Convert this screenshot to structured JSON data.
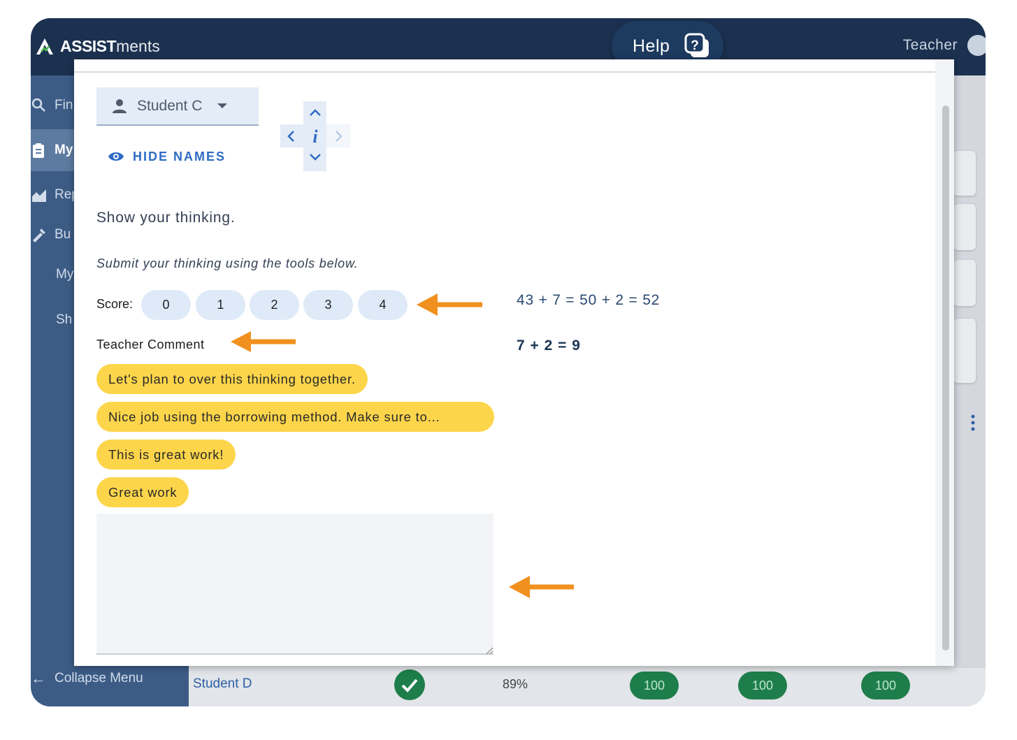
{
  "app": {
    "logo_bold": "ASSIST",
    "logo_thin": "ments",
    "user_role": "Teacher",
    "help_label": "Help"
  },
  "sidebar": {
    "items": [
      {
        "label": "Fin",
        "icon": "search-icon"
      },
      {
        "label": "My",
        "icon": "clipboard-icon"
      },
      {
        "label": "Rep",
        "icon": "chart-icon"
      },
      {
        "label": "Bu",
        "icon": "build-icon"
      },
      {
        "label": "My",
        "icon": ""
      },
      {
        "label": "Sh",
        "icon": ""
      }
    ],
    "collapse_label": "Collapse Menu"
  },
  "background_row": {
    "student": "Student D",
    "percent": "89%",
    "scores": [
      "100",
      "100",
      "100"
    ]
  },
  "modal": {
    "student_select": "Student C",
    "hide_names": "HIDE NAMES",
    "prompt": "Show your thinking.",
    "instruction": "Submit your thinking using the tools below.",
    "score_label": "Score:",
    "score_options": [
      "0",
      "1",
      "2",
      "3",
      "4"
    ],
    "teacher_comment_label": "Teacher Comment",
    "comment_chips": [
      "Let's plan to over this thinking together.",
      "Nice job using the borrowing method. Make sure to...",
      "This is great work!",
      "Great work"
    ],
    "comment_value": "",
    "student_answer": {
      "line1": "43 + 7 = 50 + 2 = 52",
      "line2": "7 + 2 = 9"
    }
  },
  "colors": {
    "topbar": "#1c3150",
    "sidebar": "#3c5c86",
    "chip": "#fdd54a",
    "score_pill": "#dfeaf8",
    "arrow": "#f0901e",
    "accent": "#2f6bc4"
  }
}
